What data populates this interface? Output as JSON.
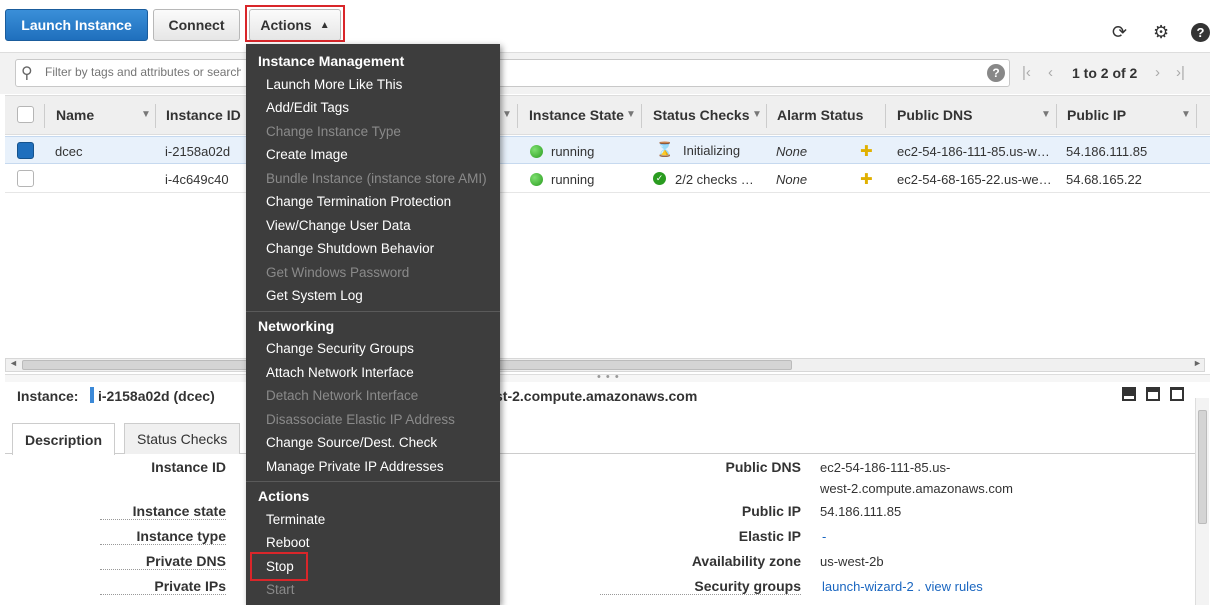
{
  "toolbar": {
    "launch_label": "Launch Instance",
    "connect_label": "Connect",
    "actions_label": "Actions",
    "actions_caret": "^",
    "icons": [
      "refresh-icon",
      "gear-icon",
      "help-icon"
    ]
  },
  "search": {
    "placeholder": "Filter by tags and attributes or search by keyword",
    "help": "?",
    "pager_text": "1 to 2 of 2"
  },
  "table": {
    "columns": [
      "Name",
      "Instance ID",
      "Instance State",
      "Status Checks",
      "Alarm Status",
      "Public DNS",
      "Public IP"
    ],
    "rows": [
      {
        "selected": true,
        "name": "dcec",
        "instance_id": "i-2158a02d",
        "state": "running",
        "status": "Initializing",
        "alarm": "None",
        "dns": "ec2-54-186-111-85.us-w…",
        "ip": "54.186.111.85"
      },
      {
        "selected": false,
        "name": "",
        "instance_id": "i-4c649c40",
        "state": "running",
        "status": "2/2 checks …",
        "alarm": "None",
        "dns": "ec2-54-68-165-22.us-we…",
        "ip": "54.68.165.22"
      }
    ]
  },
  "detail": {
    "instance_label": "Instance:",
    "instance_value": "i-2158a02d (dcec)",
    "dns_value": "st-2.compute.amazonaws.com",
    "tabs": [
      "Description",
      "Status Checks"
    ],
    "left_labels": [
      "Instance ID",
      "Instance state",
      "Instance type",
      "Private DNS",
      "Private IPs"
    ],
    "right": {
      "public_dns_label": "Public DNS",
      "public_dns_line1": "ec2-54-186-111-85.us-",
      "public_dns_line2": "west-2.compute.amazonaws.com",
      "public_ip_label": "Public IP",
      "public_ip_value": "54.186.111.85",
      "elastic_ip_label": "Elastic IP",
      "elastic_ip_value": "-",
      "az_label": "Availability zone",
      "az_value": "us-west-2b",
      "sg_label": "Security groups",
      "sg_value": "launch-wizard-2 .",
      "sg_link": "view rules"
    }
  },
  "menu": {
    "sections": {
      "instance_management": "Instance Management",
      "networking": "Networking",
      "actions": "Actions"
    },
    "instance_management_items": [
      {
        "label": "Launch More Like This",
        "disabled": false
      },
      {
        "label": "Add/Edit Tags",
        "disabled": false
      },
      {
        "label": "Change Instance Type",
        "disabled": true
      },
      {
        "label": "Create Image",
        "disabled": false
      },
      {
        "label": "Bundle Instance (instance store AMI)",
        "disabled": true
      },
      {
        "label": "Change Termination Protection",
        "disabled": false
      },
      {
        "label": "View/Change User Data",
        "disabled": false
      },
      {
        "label": "Change Shutdown Behavior",
        "disabled": false
      },
      {
        "label": "Get Windows Password",
        "disabled": true
      },
      {
        "label": "Get System Log",
        "disabled": false
      }
    ],
    "networking_items": [
      {
        "label": "Change Security Groups",
        "disabled": false
      },
      {
        "label": "Attach Network Interface",
        "disabled": false
      },
      {
        "label": "Detach Network Interface",
        "disabled": true
      },
      {
        "label": "Disassociate Elastic IP Address",
        "disabled": true
      },
      {
        "label": "Change Source/Dest. Check",
        "disabled": false
      },
      {
        "label": "Manage Private IP Addresses",
        "disabled": false
      }
    ],
    "actions_items": [
      {
        "label": "Terminate",
        "disabled": false
      },
      {
        "label": "Reboot",
        "disabled": false
      },
      {
        "label": "Stop",
        "disabled": false
      },
      {
        "label": "Start",
        "disabled": true
      }
    ]
  },
  "colors": {
    "accent": "#1f6fbd",
    "menu_bg": "#3d3d3d",
    "highlight_outline": "#d9262a",
    "running": "#2a9c20"
  }
}
